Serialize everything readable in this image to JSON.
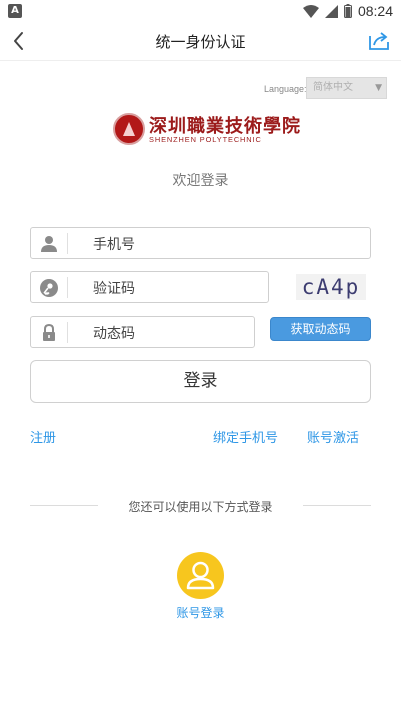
{
  "status_bar": {
    "left_icon_letter": "A",
    "time": "08:24"
  },
  "header": {
    "title": "统一身份认证",
    "back_icon": "chevron-left-icon",
    "share_icon": "share-icon"
  },
  "language": {
    "label": "Language:",
    "selected": "简体中文"
  },
  "logo": {
    "cn": "深圳職業技術學院",
    "en": "SHENZHEN POLYTECHNIC"
  },
  "welcome": "欢迎登录",
  "form": {
    "phone_placeholder": "手机号",
    "captcha_placeholder": "验证码",
    "captcha_text": "cA4p",
    "dynamic_placeholder": "动态码",
    "get_dynamic_label": "获取动态码",
    "login_label": "登录"
  },
  "links": {
    "register": "注册",
    "bind_phone": "绑定手机号",
    "activate": "账号激活"
  },
  "other_login": {
    "divider_text": "您还可以使用以下方式登录",
    "account_login": "账号登录"
  },
  "colors": {
    "accent": "#2f97e6",
    "button_blue": "#4a9ae0",
    "account_circle": "#f7c61e"
  }
}
